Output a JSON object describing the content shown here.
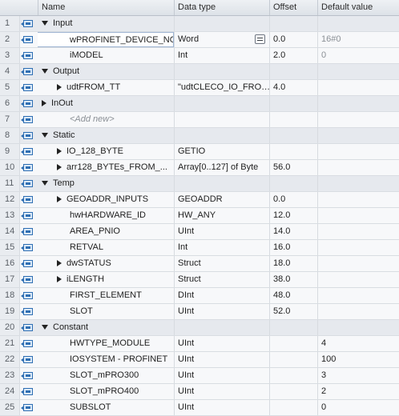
{
  "header": {
    "name": "Name",
    "data_type": "Data type",
    "offset": "Offset",
    "default_value": "Default value"
  },
  "rows": [
    {
      "num": "1",
      "kind": "group",
      "expand": "down",
      "name": "Input",
      "type": "",
      "offset": "",
      "def": ""
    },
    {
      "num": "2",
      "kind": "var",
      "name": "wPROFINET_DEVICE_NO",
      "type": "Word",
      "offset": "0.0",
      "def": "16#0",
      "def_muted": true,
      "selected": true
    },
    {
      "num": "3",
      "kind": "var",
      "name": "iMODEL",
      "type": "Int",
      "offset": "2.0",
      "def": "0",
      "def_muted": true
    },
    {
      "num": "4",
      "kind": "group",
      "expand": "down",
      "name": "Output",
      "type": "",
      "offset": "",
      "def": ""
    },
    {
      "num": "5",
      "kind": "var",
      "expand": "right",
      "name": "udtFROM_TT",
      "type": "\"udtCLECO_IO_FRO…",
      "offset": "4.0",
      "def": ""
    },
    {
      "num": "6",
      "kind": "group",
      "expand": "right",
      "name": "InOut",
      "type": "",
      "offset": "",
      "def": ""
    },
    {
      "num": "7",
      "kind": "add",
      "name": "<Add new>",
      "type": "",
      "offset": "",
      "def": ""
    },
    {
      "num": "8",
      "kind": "group",
      "expand": "down",
      "name": "Static",
      "type": "",
      "offset": "",
      "def": ""
    },
    {
      "num": "9",
      "kind": "var",
      "expand": "right",
      "name": "IO_128_BYTE",
      "type": "GETIO",
      "offset": "",
      "def": ""
    },
    {
      "num": "10",
      "kind": "var",
      "expand": "right",
      "name": "arr128_BYTEs_FROM_...",
      "type": "Array[0..127] of Byte",
      "offset": "56.0",
      "def": ""
    },
    {
      "num": "11",
      "kind": "group",
      "expand": "down",
      "name": "Temp",
      "type": "",
      "offset": "",
      "def": ""
    },
    {
      "num": "12",
      "kind": "var",
      "expand": "right",
      "name": "GEOADDR_INPUTS",
      "type": "GEOADDR",
      "offset": "0.0",
      "def": ""
    },
    {
      "num": "13",
      "kind": "var",
      "name": "hwHARDWARE_ID",
      "type": "HW_ANY",
      "offset": "12.0",
      "def": ""
    },
    {
      "num": "14",
      "kind": "var",
      "name": "AREA_PNIO",
      "type": "UInt",
      "offset": "14.0",
      "def": ""
    },
    {
      "num": "15",
      "kind": "var",
      "name": "RETVAL",
      "type": "Int",
      "offset": "16.0",
      "def": ""
    },
    {
      "num": "16",
      "kind": "var",
      "expand": "right",
      "name": "dwSTATUS",
      "type": "Struct",
      "offset": "18.0",
      "def": ""
    },
    {
      "num": "17",
      "kind": "var",
      "expand": "right",
      "name": "iLENGTH",
      "type": "Struct",
      "offset": "38.0",
      "def": ""
    },
    {
      "num": "18",
      "kind": "var",
      "name": "FIRST_ELEMENT",
      "type": "DInt",
      "offset": "48.0",
      "def": ""
    },
    {
      "num": "19",
      "kind": "var",
      "name": "SLOT",
      "type": "UInt",
      "offset": "52.0",
      "def": ""
    },
    {
      "num": "20",
      "kind": "group",
      "expand": "down",
      "name": "Constant",
      "type": "",
      "offset": "",
      "def": ""
    },
    {
      "num": "21",
      "kind": "var",
      "name": "HWTYPE_MODULE",
      "type": "UInt",
      "offset": "",
      "def": "4"
    },
    {
      "num": "22",
      "kind": "var",
      "name": "IOSYSTEM - PROFINET",
      "type": "UInt",
      "offset": "",
      "def": "100"
    },
    {
      "num": "23",
      "kind": "var",
      "name": "SLOT_mPRO300",
      "type": "UInt",
      "offset": "",
      "def": "3"
    },
    {
      "num": "24",
      "kind": "var",
      "name": "SLOT_mPRO400",
      "type": "UInt",
      "offset": "",
      "def": "2"
    },
    {
      "num": "25",
      "kind": "var",
      "name": "SUBSLOT",
      "type": "UInt",
      "offset": "",
      "def": "0"
    }
  ]
}
